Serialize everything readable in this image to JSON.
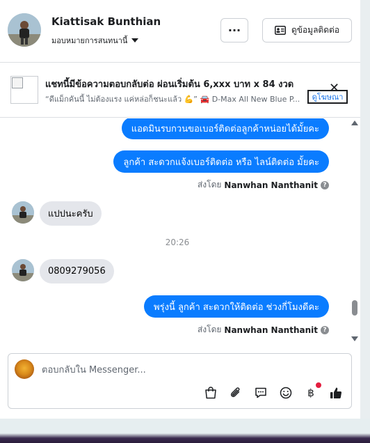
{
  "header": {
    "contact_name": "Kiattisak Bunthian",
    "assign_label": "มอบหมายการสนทนานี้",
    "more_label": "···",
    "contact_info_label": "ดูข้อมูลติดต่อ"
  },
  "ad": {
    "title": "แชทนี้มีข้อความตอบกลับต่อ ผ่อนเริ่มต้น 6,xxx บาท x 84 งวด",
    "subtitle": "“ดีแม็กคันนี้ ไม่ต้องแรง แค่หล่อก็ชนะแล้ว 💪” 🚘 D-Max All New Blue P...",
    "link_label": "ดูโฆษณา",
    "close_label": "✕"
  },
  "messages": {
    "out_1": "แอดมินรบกวนขอเบอร์ติดต่อลูกค้าหน่อยได้มั้ยคะ",
    "out_2": "ลูกค้า  สะดวกแจ้งเบอร์ติดต่อ หรือ ไลน์ติดต่อ มั้ยคะ",
    "sent_by_prefix_1": "ส่งโดย",
    "sent_by_name_1": "Nanwhan Nanthanit",
    "in_1": "แปปนะครับ",
    "timestamp": "20:26",
    "in_2": "0809279056",
    "out_3": "พรุ่งนี้ ลูกค้า  สะดวกให้ติดต่อ ช่วงกี่โมงดีคะ",
    "sent_by_prefix_2": "ส่งโดย",
    "sent_by_name_2": "Nanwhan Nanthanit"
  },
  "composer": {
    "placeholder": "ตอบกลับใน Messenger..."
  },
  "colors": {
    "outgoing_bubble": "#0a7cff",
    "incoming_bubble": "#e4e6eb",
    "like_button": "#1c1e21",
    "notification_dot": "#e41e3f"
  },
  "icons": [
    "more-icon",
    "contact-card-icon",
    "close-icon",
    "shopping-bag-icon",
    "attachment-icon",
    "saved-reply-icon",
    "emoji-icon",
    "payment-icon",
    "like-icon",
    "help-icon"
  ]
}
